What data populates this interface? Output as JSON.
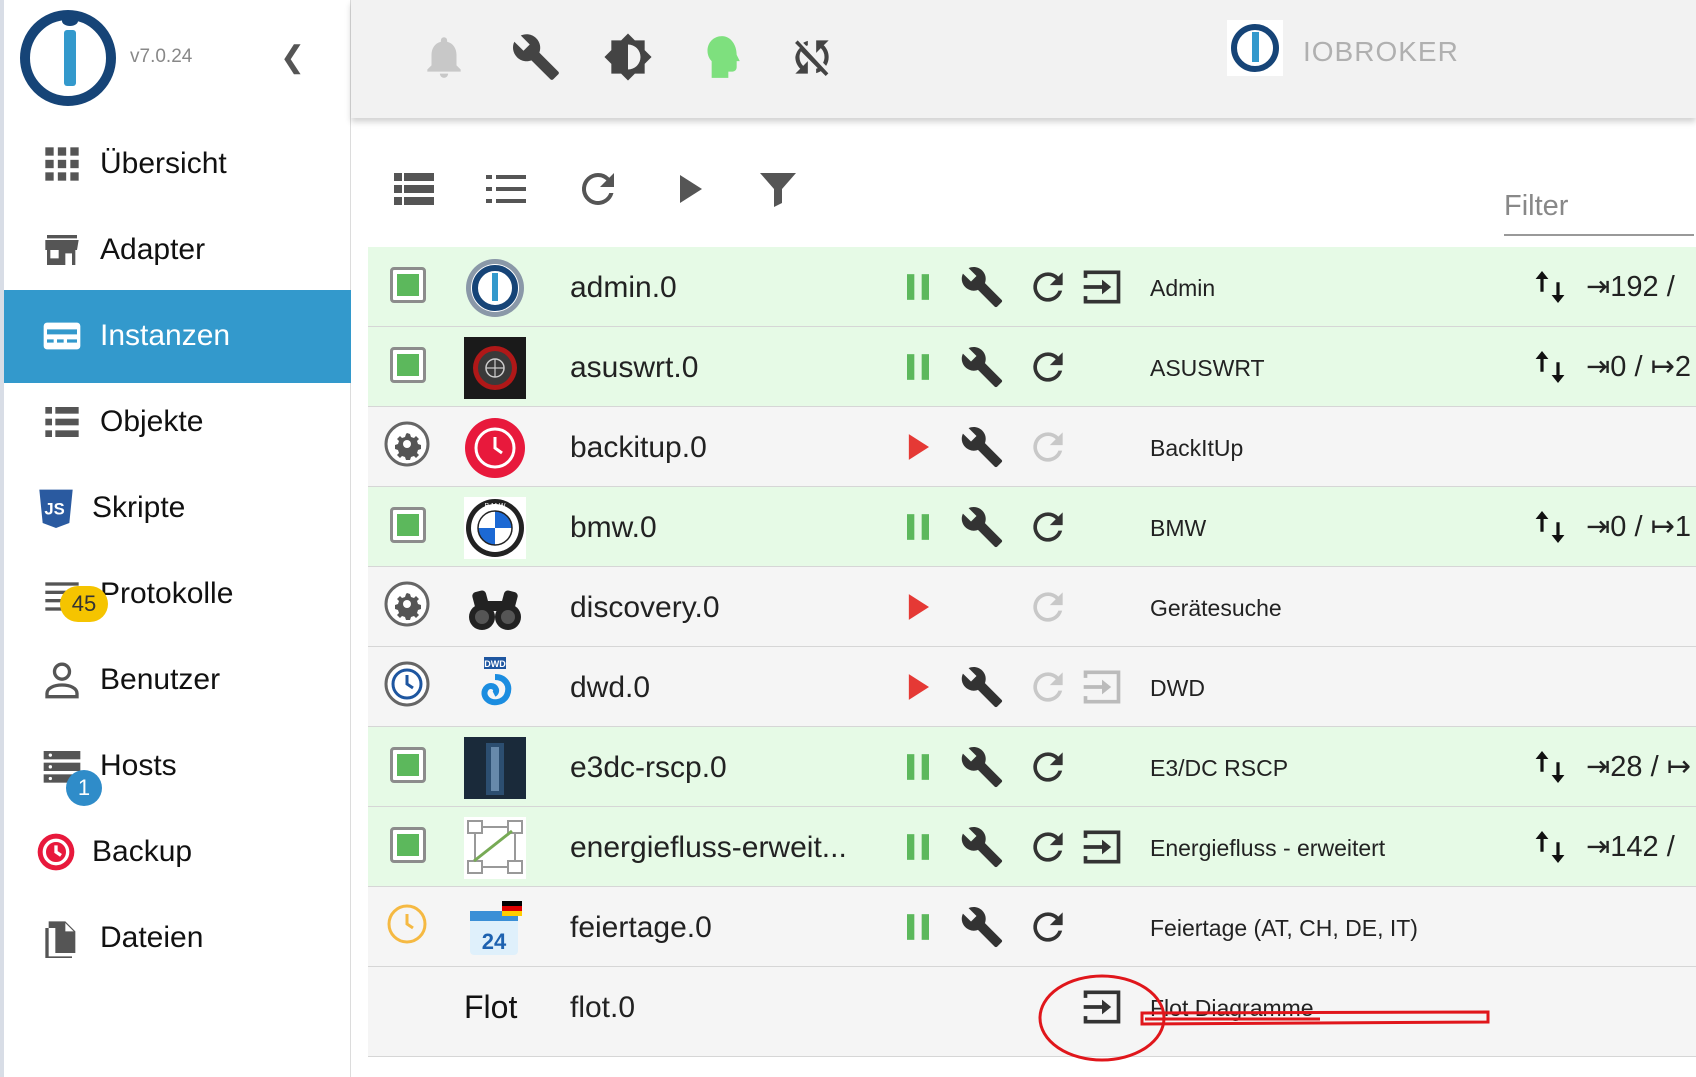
{
  "sidebar": {
    "version": "v7.0.24",
    "collapse_icon": "chevron-left-icon",
    "items": [
      {
        "label": "Übersicht",
        "icon": "grid-icon"
      },
      {
        "label": "Adapter",
        "icon": "store-icon"
      },
      {
        "label": "Instanzen",
        "icon": "instances-icon"
      },
      {
        "label": "Objekte",
        "icon": "list-icon"
      },
      {
        "label": "Skripte",
        "icon": "js-icon"
      },
      {
        "label": "Protokolle",
        "icon": "log-icon"
      },
      {
        "label": "Benutzer",
        "icon": "user-icon"
      },
      {
        "label": "Hosts",
        "icon": "hosts-icon"
      },
      {
        "label": "Backup",
        "icon": "backup-icon"
      },
      {
        "label": "Dateien",
        "icon": "files-icon"
      }
    ],
    "badges": {
      "protokolle": "45",
      "hosts": "1"
    }
  },
  "topbar": {
    "brand": "IOBROKER"
  },
  "toolbar": {
    "filter_label": "Filter"
  },
  "instances": [
    {
      "name": "admin.0",
      "title": "Admin",
      "status": "running",
      "events": "⇥192 /"
    },
    {
      "name": "asuswrt.0",
      "title": "ASUSWRT",
      "status": "running",
      "events": "⇥0 / ↦2"
    },
    {
      "name": "backitup.0",
      "title": "BackItUp",
      "status": "stopped",
      "events": ""
    },
    {
      "name": "bmw.0",
      "title": "BMW",
      "status": "running",
      "events": "⇥0 / ↦1"
    },
    {
      "name": "discovery.0",
      "title": "Gerätesuche",
      "status": "stopped",
      "events": ""
    },
    {
      "name": "dwd.0",
      "title": "DWD",
      "status": "scheduled",
      "events": ""
    },
    {
      "name": "e3dc-rscp.0",
      "title": "E3/DC RSCP",
      "status": "running",
      "events": "⇥28 / ↦"
    },
    {
      "name": "energiefluss-erweit...",
      "title": "Energiefluss - erweitert",
      "status": "running",
      "events": "⇥142 /"
    },
    {
      "name": "feiertage.0",
      "title": "Feiertage (AT, CH, DE, IT)",
      "status": "scheduled",
      "events": ""
    },
    {
      "name": "flot.0",
      "title": "Flot Diagramme",
      "status": "none",
      "events": ""
    }
  ],
  "flot_logo_text": "Flot",
  "bmw_text": "B M W",
  "dwd_text": "DWD",
  "feiertage_day": "24",
  "colors": {
    "accent": "#3399cc",
    "running_row": "#e6fae6",
    "stopped_row": "#f5f5f5",
    "green": "#5cb85c",
    "red": "#e53935",
    "annotation": "#e0161b"
  }
}
